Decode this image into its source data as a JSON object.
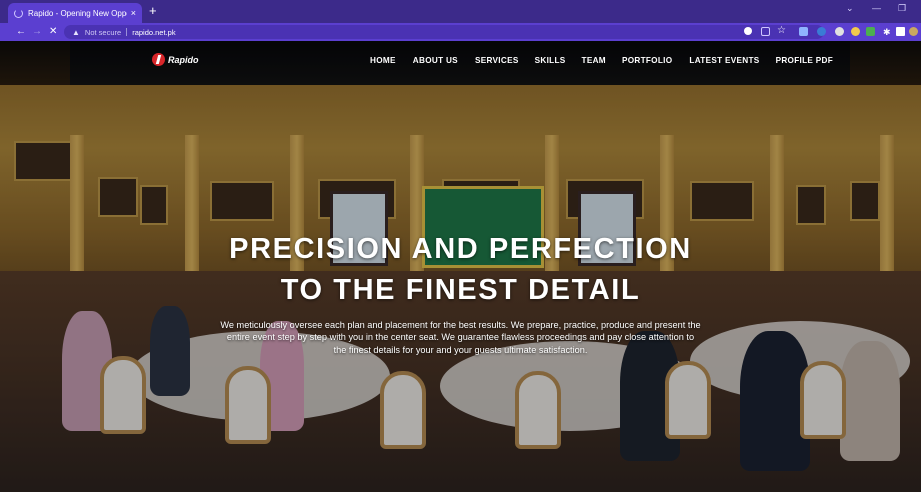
{
  "browser": {
    "tab_title": "Rapido - Opening New Opportu",
    "tab_close": "×",
    "new_tab": "+",
    "security_label": "Not secure",
    "url": "rapido.net.pk",
    "window_controls": [
      "⌄",
      "—",
      "❐"
    ]
  },
  "site": {
    "logo_text": "Rapido",
    "nav": [
      "HOME",
      "ABOUT US",
      "SERVICES",
      "SKILLS",
      "TEAM",
      "PORTFOLIO",
      "LATEST EVENTS",
      "PROFILE PDF"
    ]
  },
  "hero": {
    "headline_line1": "PRECISION AND PERFECTION",
    "headline_line2": "TO THE FINEST DETAIL",
    "subtext": "We meticulously oversee each plan and placement for the best results. We prepare, practice, produce and present the entire event step by step with you in the center seat. We guarantee flawless proceedings and pay close attention to the finest details for your and your guests ultimate satisfaction."
  },
  "colors": {
    "tabbar": "#3c2a8a",
    "toolbar": "#5b3fd0",
    "logo_red": "#d8262a"
  }
}
